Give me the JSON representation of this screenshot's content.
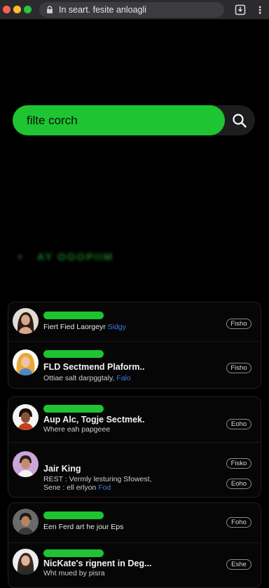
{
  "browser": {
    "url_text": "In seart. fesite anloagli"
  },
  "search": {
    "placeholder": "filte corch"
  },
  "section": {
    "heading": "AY OOOPIIM"
  },
  "colors": {
    "accent_green": "#1ec431",
    "link_blue": "#3d7be0",
    "background": "#000000"
  },
  "items": [
    {
      "title": "",
      "subtitle": "Fiert Fied Laorgeyr",
      "subtitle_link": "Sidgy",
      "button": "Fisho"
    },
    {
      "title": "FLD Sectmend Plaform..",
      "subtitle": "Ottiae salt darpggtaly,",
      "subtitle_link": "Falo",
      "button": "Fisho"
    },
    {
      "title": "Aup Alc, Togje Sectmek.",
      "subtitle": "Where eah papgeee",
      "subtitle_link": "",
      "button": "Eoho"
    },
    {
      "title": "Jair King",
      "subtitle": "REST : Vermly lesturing Sfowest,",
      "subtitle2": "Sene : ell erlyon",
      "subtitle2_link": "Fod",
      "button": "Fisko",
      "button2": "Eoho"
    },
    {
      "title": "",
      "subtitle": "Een Ferd art he jour Eps",
      "subtitle_link": "",
      "button": "Foho"
    },
    {
      "title": "NicKate's rignent in Deg...",
      "subtitle": "Wht mued by pisra",
      "subtitle_link": "",
      "button": "Eshe"
    }
  ]
}
